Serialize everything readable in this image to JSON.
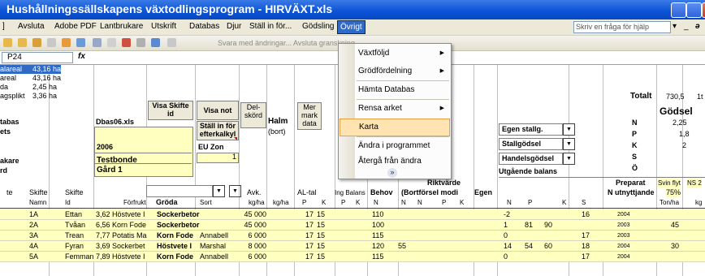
{
  "window": {
    "title": "Hushållningssällskapens växtodlingsprogram - HIRVÄXT.xls"
  },
  "menubar": {
    "items": [
      "Avsluta",
      "Adobe PDF",
      "Lantbrukare",
      "Utskrift",
      "Databas",
      "Djur",
      "Ställ in för...",
      "Gödsling",
      "Övrigt"
    ],
    "help_placeholder": "Skriv en fråga för hjälp"
  },
  "toolbar": {
    "review_text": "Svara med ändringar...  Avsluta granskning..."
  },
  "formula": {
    "cell_ref": "P24",
    "fx": "fx"
  },
  "menu": {
    "items": [
      {
        "label": "Växtföljd",
        "submenu": true
      },
      {
        "label": "Grödfördelning",
        "submenu": true
      },
      {
        "label": "Hämta Databas",
        "submenu": false
      },
      {
        "label": "Rensa arket",
        "submenu": true
      },
      {
        "label": "Karta",
        "submenu": false
      },
      {
        "label": "Ändra i programmet",
        "submenu": false
      },
      {
        "label": "Återgå från ändra",
        "submenu": false
      }
    ],
    "more": "»"
  },
  "summary": {
    "lines": [
      {
        "label": "alareal",
        "value": "43,16 ha"
      },
      {
        "label": "areal",
        "value": "43,16 ha"
      },
      {
        "label": "da",
        "value": "2,45 ha"
      },
      {
        "label": "agsplikt",
        "value": "3,36 ha"
      }
    ]
  },
  "farm": {
    "labels": [
      "tabas",
      "ets",
      "akare",
      "rd"
    ],
    "dbfile": "Dbas06.xls",
    "year": "2006",
    "name": "Testbonde",
    "farm": "Gård 1"
  },
  "buttons": {
    "visa_skifte": "Visa Skifte id",
    "visa_not": "Visa not",
    "stall_in": "Ställ in för efterkalkyl",
    "eu_zon": "EU Zon",
    "eu_zon_value": "1",
    "delskord": "Del-skörd",
    "halm": "Halm",
    "bort": "(bort)",
    "mer_data": "Mer mark data"
  },
  "right": {
    "totalt": "Totalt",
    "totalt_value": "730,5",
    "totalt_tail": "1t",
    "godsel": "Gödsel",
    "n_values": [
      {
        "k": "N",
        "v": "2,25"
      },
      {
        "k": "P",
        "v": "1,8"
      },
      {
        "k": "K",
        "v": "2"
      },
      {
        "k": "S",
        "v": ""
      },
      {
        "k": "Ö",
        "v": ""
      }
    ],
    "dropdowns": [
      "Egen stallg.",
      "Stallgödsel",
      "Handelsgödsel"
    ],
    "utgaende": "Utgående balans",
    "preparat": "Preparat",
    "svin": "Svin flyt",
    "ns2": "NS 2",
    "n_utnyttjande": "N utnyttjande",
    "pct": "75%",
    "ton_ha": "Ton/ha",
    "kg": "kg"
  },
  "headers": {
    "row1": [
      "te",
      "Skifte",
      "Skifte",
      "Avk.",
      "AL-tal",
      "Ing Balans",
      "Behov",
      "Riktvärde",
      "(Bortförsel modi",
      "Egen"
    ],
    "row2": [
      "Namn",
      "Id",
      "Förfrukt",
      "Gröda",
      "Sort",
      "kg/ha",
      "kg/ha",
      "P",
      "K",
      "P",
      "K",
      "N",
      "N",
      "N",
      "P",
      "K",
      "N",
      "P",
      "K",
      "S"
    ]
  },
  "rows": [
    {
      "nr": "1A",
      "id": "Ettan",
      "ff": "3,62 Höstvete I",
      "groda": "Sockerbetor",
      "sort": "",
      "avk": "45 000",
      "p": "17",
      "k": "15",
      "behov": "110",
      "rv": "",
      "n": "-2",
      "pp": "",
      "kk": "",
      "s": "16",
      "yr": "2004",
      "t": ""
    },
    {
      "nr": "2A",
      "id": "Tvåan",
      "ff": "6,56 Korn Fode",
      "groda": "Sockerbetor",
      "sort": "",
      "avk": "45 000",
      "p": "17",
      "k": "15",
      "behov": "100",
      "rv": "",
      "n": "1",
      "pp": "81",
      "kk": "90",
      "s": "",
      "yr": "2003",
      "t": "45"
    },
    {
      "nr": "3A",
      "id": "Trean",
      "ff": "7,77 Potatis Ma",
      "groda": "Korn Fode",
      "sort": "Annabell",
      "avk": "6 000",
      "p": "17",
      "k": "15",
      "behov": "115",
      "rv": "",
      "n": "0",
      "pp": "",
      "kk": "",
      "s": "17",
      "yr": "2003",
      "t": ""
    },
    {
      "nr": "4A",
      "id": "Fyran",
      "ff": "3,69 Sockerbet",
      "groda": "Höstvete I",
      "sort": "Marshal",
      "avk": "8 000",
      "p": "17",
      "k": "15",
      "behov": "120",
      "rv": "55",
      "n": "14",
      "pp": "54",
      "kk": "60",
      "s": "18",
      "yr": "2004",
      "t": "30"
    },
    {
      "nr": "5A",
      "id": "Femman",
      "ff": "7,89 Höstvete I",
      "groda": "Korn Fode",
      "sort": "Annabell",
      "avk": "6 000",
      "p": "17",
      "k": "15",
      "behov": "115",
      "rv": "",
      "n": "0",
      "pp": "",
      "kk": "",
      "s": "17",
      "yr": "2004",
      "t": ""
    }
  ]
}
